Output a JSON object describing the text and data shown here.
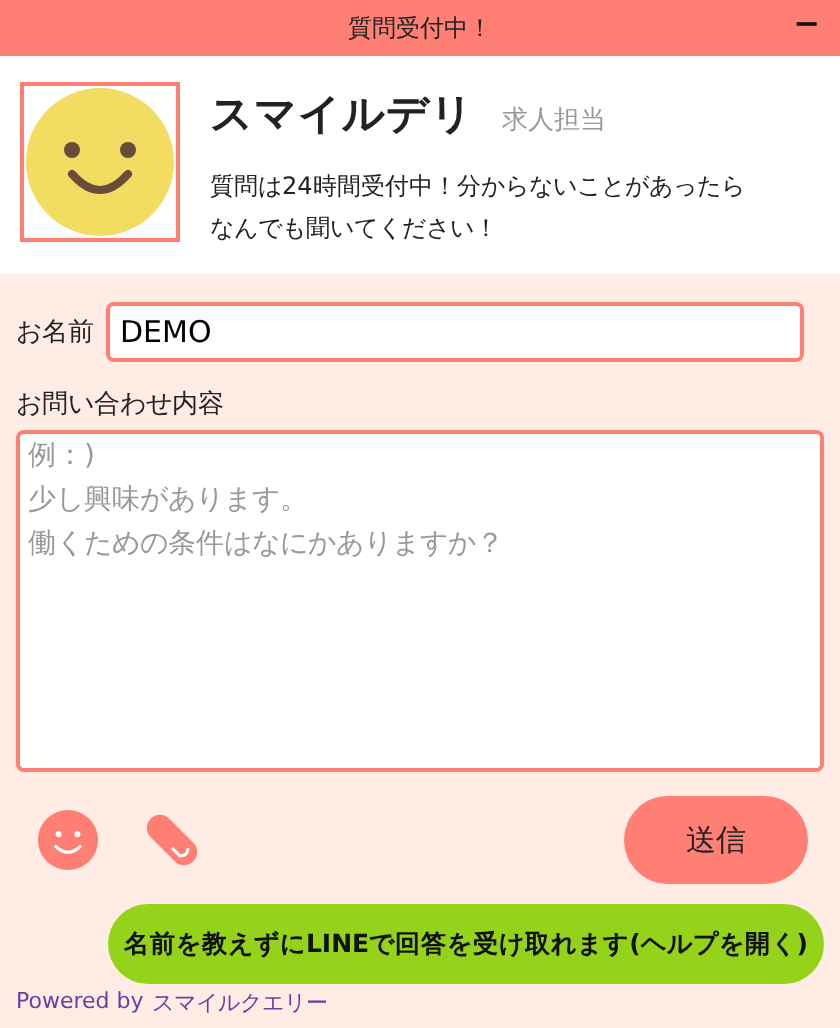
{
  "header": {
    "title": "質問受付中！",
    "minimize": "−"
  },
  "profile": {
    "name": "スマイルデリ",
    "role": "求人担当",
    "message": "質問は24時間受付中！分からないことがあったらなんでも聞いてください！"
  },
  "form": {
    "name_label": "お名前",
    "name_value": "DEMO",
    "inquiry_label": "お問い合わせ内容",
    "inquiry_placeholder": [
      "例：)",
      "少し興味があります。",
      "働くための条件はなにかありますか？"
    ]
  },
  "send_button": "送信",
  "line_button": "名前を教えずにLINEで回答を受け取れます(ヘルプを開く)",
  "footer": {
    "powered": "Powered by",
    "brand": "スマイルクエリー"
  }
}
